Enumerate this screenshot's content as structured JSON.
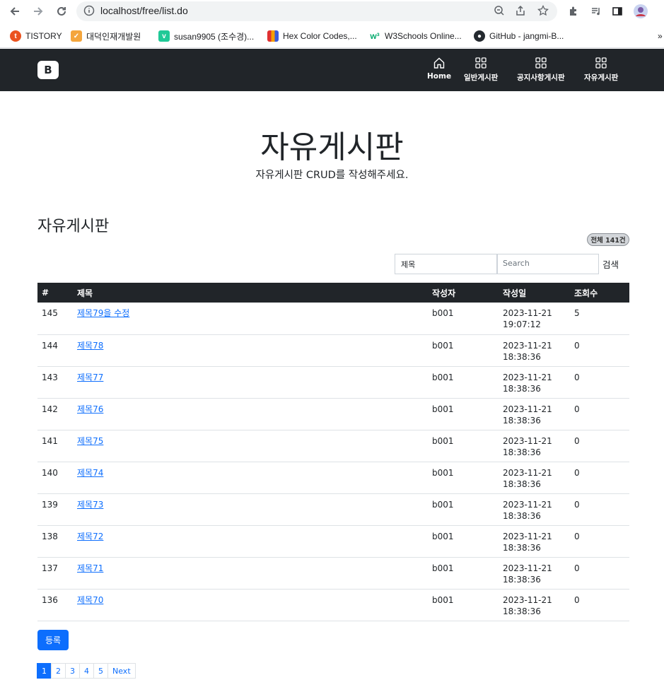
{
  "browser": {
    "url": "localhost/free/list.do",
    "bookmarks": [
      {
        "label": "TISTORY",
        "icon": "tistory-icon",
        "color": "#eb531f"
      },
      {
        "label": "대덕인재개발원",
        "icon": "ddit-icon",
        "color": "#f4a53c"
      },
      {
        "label": "susan9905 (조수경)...",
        "icon": "velog-icon",
        "color": "#20c997"
      },
      {
        "label": "Hex Color Codes,...",
        "icon": "hex-color-icon",
        "color": "#3b5bdb"
      },
      {
        "label": "W3Schools Online...",
        "icon": "w3schools-icon",
        "color": "#04aa6d"
      },
      {
        "label": "GitHub - jangmi-B...",
        "icon": "github-icon",
        "color": "#24292f"
      }
    ],
    "overflow": "»"
  },
  "navbar": {
    "brand": "B",
    "items": [
      {
        "label": "Home",
        "icon": "home-icon"
      },
      {
        "label": "일반게시판",
        "icon": "grid-icon"
      },
      {
        "label": "공지사항게시판",
        "icon": "grid-icon"
      },
      {
        "label": "자유게시판",
        "icon": "grid-icon"
      }
    ]
  },
  "hero": {
    "title": "자유게시판",
    "subtitle": "자유게시판 CRUD를 작성해주세요."
  },
  "board": {
    "title": "자유게시판",
    "total_badge": "전체 141건",
    "search": {
      "select_value": "제목",
      "placeholder": "Search",
      "button": "검색"
    },
    "columns": [
      "#",
      "제목",
      "작성자",
      "작성일",
      "조회수"
    ],
    "rows": [
      {
        "no": "145",
        "title": "제목79을 수정",
        "writer": "b001",
        "date": "2023-11-21",
        "time": "19:07:12",
        "hit": "5"
      },
      {
        "no": "144",
        "title": "제목78",
        "writer": "b001",
        "date": "2023-11-21",
        "time": "18:38:36",
        "hit": "0"
      },
      {
        "no": "143",
        "title": "제목77",
        "writer": "b001",
        "date": "2023-11-21",
        "time": "18:38:36",
        "hit": "0"
      },
      {
        "no": "142",
        "title": "제목76",
        "writer": "b001",
        "date": "2023-11-21",
        "time": "18:38:36",
        "hit": "0"
      },
      {
        "no": "141",
        "title": "제목75",
        "writer": "b001",
        "date": "2023-11-21",
        "time": "18:38:36",
        "hit": "0"
      },
      {
        "no": "140",
        "title": "제목74",
        "writer": "b001",
        "date": "2023-11-21",
        "time": "18:38:36",
        "hit": "0"
      },
      {
        "no": "139",
        "title": "제목73",
        "writer": "b001",
        "date": "2023-11-21",
        "time": "18:38:36",
        "hit": "0"
      },
      {
        "no": "138",
        "title": "제목72",
        "writer": "b001",
        "date": "2023-11-21",
        "time": "18:38:36",
        "hit": "0"
      },
      {
        "no": "137",
        "title": "제목71",
        "writer": "b001",
        "date": "2023-11-21",
        "time": "18:38:36",
        "hit": "0"
      },
      {
        "no": "136",
        "title": "제목70",
        "writer": "b001",
        "date": "2023-11-21",
        "time": "18:38:36",
        "hit": "0"
      }
    ],
    "register_button": "등록",
    "pagination": [
      "1",
      "2",
      "3",
      "4",
      "5",
      "Next"
    ]
  },
  "colors": {
    "navbar_bg": "#212529",
    "primary": "#0d6efd"
  }
}
